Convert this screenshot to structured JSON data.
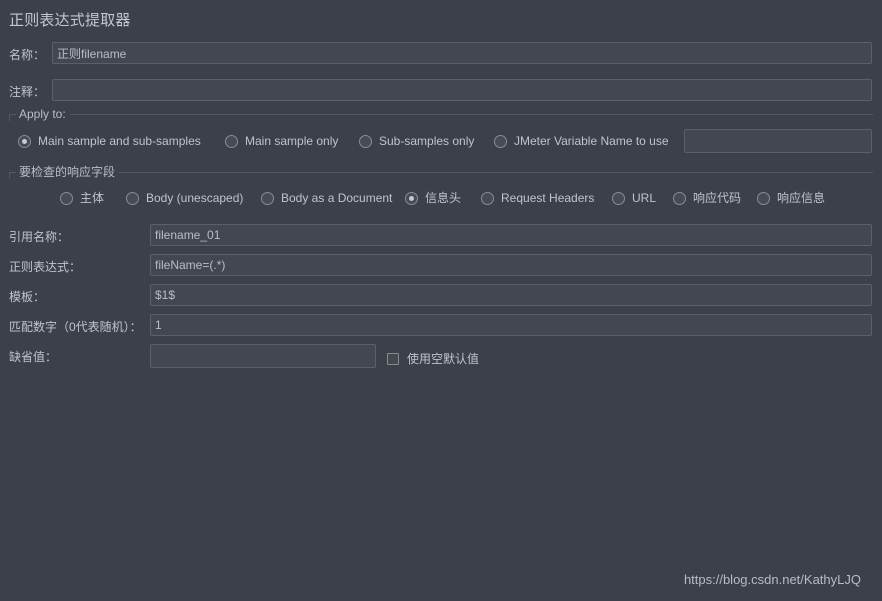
{
  "window": {
    "title": "正则表达式提取器",
    "background_color": "#3c4048",
    "text_color": "#bfc4cc"
  },
  "fields": {
    "name": {
      "label": "名称：",
      "value": "正则filename",
      "placeholder": ""
    },
    "comment": {
      "label": "注释：",
      "value": "",
      "placeholder": ""
    },
    "reference_name": {
      "label": "引用名称：",
      "value": "filename_01",
      "placeholder": ""
    },
    "regex": {
      "label": "正则表达式：",
      "value": "fileName=(.*)",
      "placeholder": ""
    },
    "template": {
      "label": "模板：",
      "value": "$1$",
      "placeholder": ""
    },
    "match_no": {
      "label": "匹配数字（0代表随机）：",
      "value": "1",
      "placeholder": ""
    },
    "default_value": {
      "label": "缺省值：",
      "value": "",
      "placeholder": ""
    },
    "jmeter_variable": {
      "value": "",
      "placeholder": ""
    }
  },
  "apply_to": {
    "legend": "Apply to:",
    "options": [
      {
        "label": "Main sample and sub-samples",
        "selected": true
      },
      {
        "label": "Main sample only",
        "selected": false
      },
      {
        "label": "Sub-samples only",
        "selected": false
      },
      {
        "label": "JMeter Variable Name to use",
        "selected": false
      }
    ]
  },
  "response_field": {
    "legend": "要检查的响应字段",
    "options": [
      {
        "label": "主体",
        "selected": false
      },
      {
        "label": "Body (unescaped)",
        "selected": false
      },
      {
        "label": "Body as a Document",
        "selected": false
      },
      {
        "label": "信息头",
        "selected": true
      },
      {
        "label": "Request Headers",
        "selected": false
      },
      {
        "label": "URL",
        "selected": false
      },
      {
        "label": "响应代码",
        "selected": false
      },
      {
        "label": "响应信息",
        "selected": false
      }
    ]
  },
  "empty_default_checkbox": {
    "label": "使用空默认值",
    "checked": false
  },
  "watermark": {
    "text": "https://blog.csdn.net/KathyLJQ"
  }
}
